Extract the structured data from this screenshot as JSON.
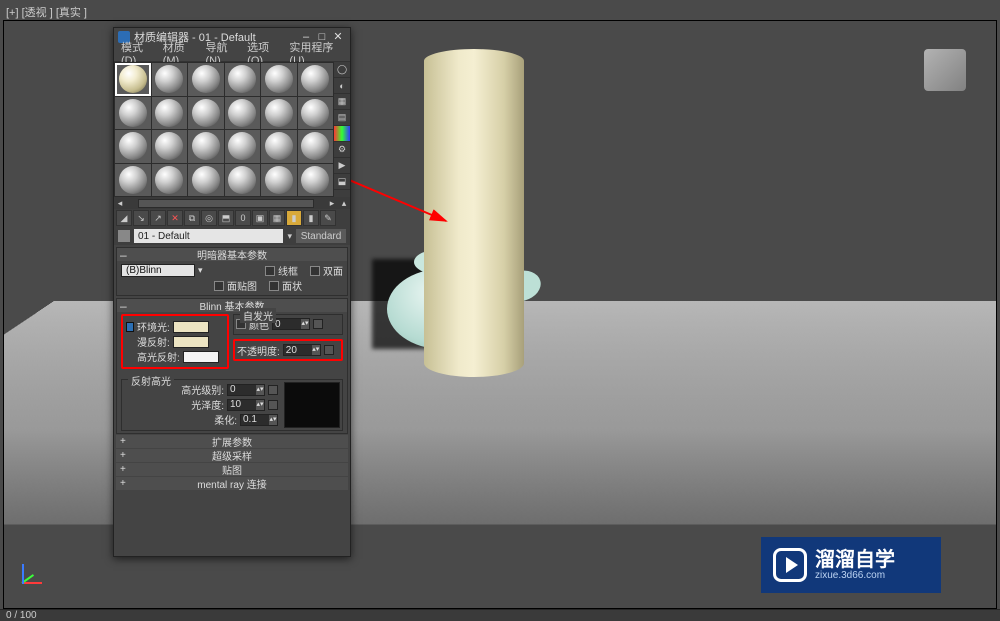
{
  "viewport_label": "[+] [透视 ] [真实 ]",
  "timeline": "0 / 100",
  "watermark": {
    "brand": "溜溜自学",
    "url": "zixue.3d66.com"
  },
  "mat_editor": {
    "title": "材质编辑器 - 01 - Default",
    "window_buttons": {
      "min": "–",
      "max": "□",
      "close": "✕"
    },
    "menu": {
      "mode": "模式(D)",
      "material": "材质(M)",
      "navigate": "导航(N)",
      "options": "选项(O)",
      "utilities": "实用程序(U)"
    },
    "selected_name": "01 - Default",
    "type_button": "Standard",
    "rollouts": {
      "shader_basic": {
        "title": "明暗器基本参数",
        "shader": "(B)Blinn",
        "wireframe": "线框",
        "two_sided": "双面",
        "face_map": "面贴图",
        "faceted": "面状"
      },
      "blinn_basic": {
        "title": "Blinn 基本参数",
        "self_illum_group": "自发光",
        "self_illum_color_label": "颜色",
        "self_illum_value": "0",
        "ambient_label": "环境光:",
        "diffuse_label": "漫反射:",
        "specular_label": "高光反射:",
        "opacity_label": "不透明度:",
        "opacity_value": "20",
        "specular_hl_group": "反射高光",
        "spec_level_label": "高光级别:",
        "spec_level_value": "0",
        "glossiness_label": "光泽度:",
        "glossiness_value": "10",
        "soften_label": "柔化:",
        "soften_value": "0.1"
      },
      "extended": "扩展参数",
      "supersampling": "超级采样",
      "maps": "贴图",
      "mental_ray": "mental ray 连接"
    }
  }
}
